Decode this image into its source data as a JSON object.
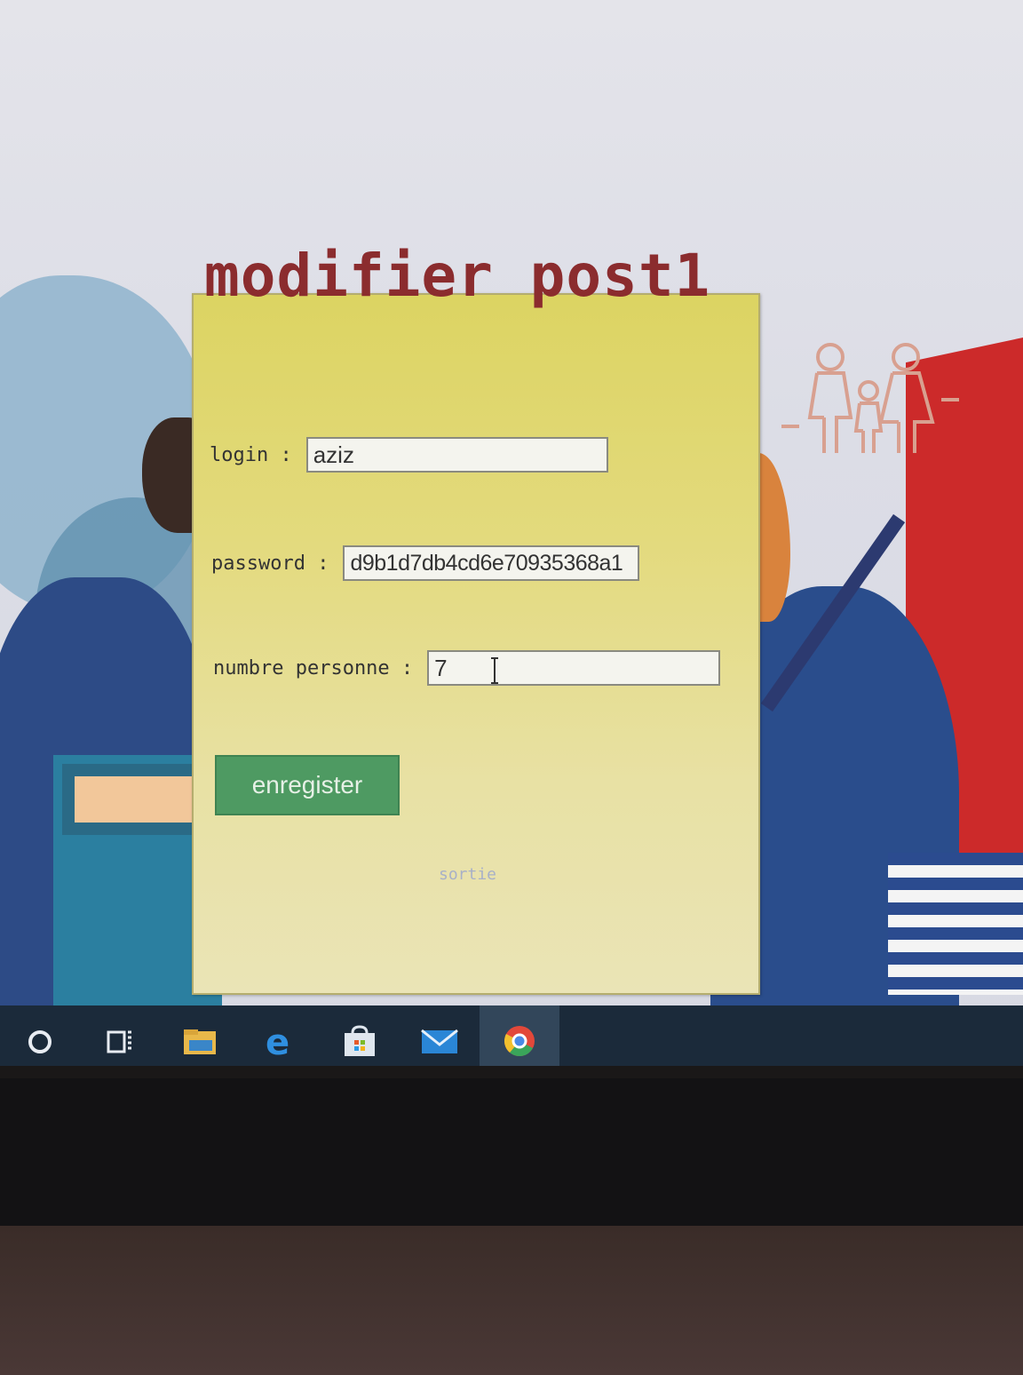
{
  "dialog": {
    "title": "modifier post1",
    "login_label": "login :",
    "login_value": "aziz",
    "password_label": "password :",
    "password_value": "d9b1d7db4cd6e70935368a1",
    "persons_label": "numbre personne :",
    "persons_value": "7",
    "save_label": "enregister",
    "exit_label": "sortie"
  },
  "taskbar": {
    "items": [
      "cortana-icon",
      "task-view-icon",
      "file-explorer-icon",
      "edge-icon",
      "store-icon",
      "mail-icon",
      "chrome-icon"
    ]
  },
  "colors": {
    "title": "#8b2c2e",
    "panel": "#e3da7d",
    "button": "#4e9a62",
    "taskbar": "#1b2a3a"
  }
}
